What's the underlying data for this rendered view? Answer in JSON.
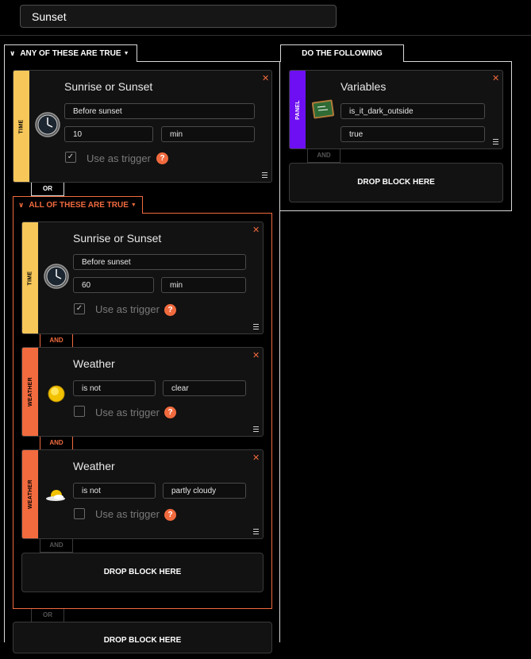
{
  "rule": {
    "name": "Sunset"
  },
  "any_group": {
    "label": "ANY OF THESE ARE TRUE",
    "time_block": {
      "category": "TIME",
      "title": "Sunrise or Sunset",
      "event": "Before sunset",
      "offset_value": "10",
      "offset_unit": "min",
      "trigger_label": "Use as trigger",
      "trigger_checked": true
    },
    "or_connector_1": "OR",
    "or_connector_2": "OR",
    "bottom_drop": "DROP BLOCK HERE"
  },
  "all_group": {
    "label": "ALL OF THESE ARE TRUE",
    "time_block": {
      "category": "TIME",
      "title": "Sunrise or Sunset",
      "event": "Before sunset",
      "offset_value": "60",
      "offset_unit": "min",
      "trigger_label": "Use as trigger",
      "trigger_checked": true
    },
    "and_connector_1": "AND",
    "weather_block_1": {
      "category": "WEATHER",
      "title": "Weather",
      "operator": "is not",
      "condition": "clear",
      "trigger_label": "Use as trigger",
      "trigger_checked": false
    },
    "and_connector_2": "AND",
    "weather_block_2": {
      "category": "WEATHER",
      "title": "Weather",
      "operator": "is not",
      "condition": "partly cloudy",
      "trigger_label": "Use as trigger",
      "trigger_checked": false
    },
    "and_connector_3": "AND",
    "drop_zone": "DROP BLOCK HERE"
  },
  "actions": {
    "label": "DO THE FOLLOWING",
    "variables_block": {
      "category": "PANEL",
      "title": "Variables",
      "variable_name": "is_it_dark_outside",
      "variable_value": "true"
    },
    "and_connector": "AND",
    "drop_zone": "DROP BLOCK HERE"
  },
  "icons": {
    "chevron": "chevron-down-icon",
    "close": "close-icon",
    "menu": "menu-icon",
    "help": "help-icon",
    "clock": "clock-icon",
    "sun": "sun-icon",
    "partly_cloudy": "partly-cloudy-icon",
    "chalkboard": "chalkboard-icon",
    "check": "checkmark-icon"
  },
  "colors": {
    "accent": "#f06a3e",
    "time": "#f7c75a",
    "weather": "#f26b3f",
    "panel": "#6d0ff2"
  }
}
